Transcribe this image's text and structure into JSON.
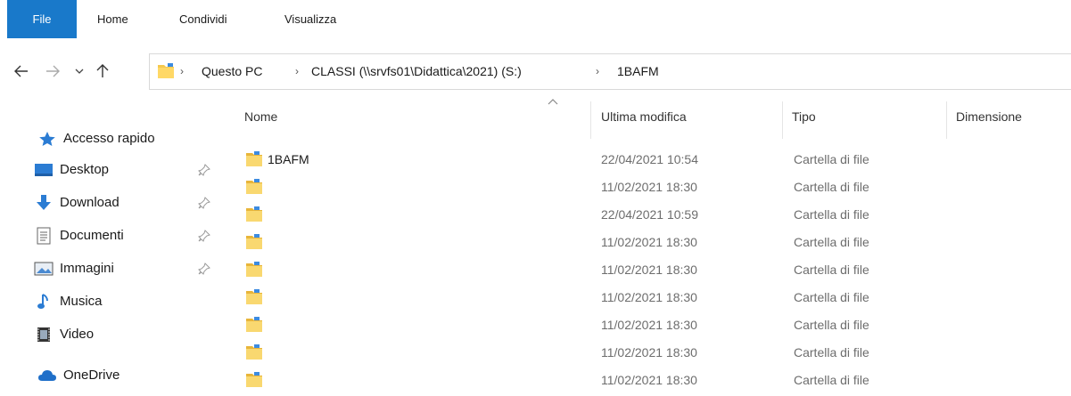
{
  "ribbon": {
    "tabs": [
      "File",
      "Home",
      "Condividi",
      "Visualizza"
    ]
  },
  "address": {
    "crumbs": [
      "Questo PC",
      "CLASSI (\\\\srvfs01\\Didattica\\2021) (S:)",
      "1BAFM"
    ],
    "folder_icon": "folder-icon"
  },
  "navigation": {
    "back_icon": "arrow-left-icon",
    "forward_icon": "arrow-right-icon",
    "recent_icon": "chevron-down-icon",
    "up_icon": "arrow-up-icon"
  },
  "sidebar": {
    "quick_access": "Accesso rapido",
    "items": [
      {
        "label": "Desktop",
        "icon": "desktop-icon",
        "pinned": true
      },
      {
        "label": "Download",
        "icon": "download-icon",
        "pinned": true
      },
      {
        "label": "Documenti",
        "icon": "documents-icon",
        "pinned": true
      },
      {
        "label": "Immagini",
        "icon": "pictures-icon",
        "pinned": true
      },
      {
        "label": "Musica",
        "icon": "music-icon",
        "pinned": false
      },
      {
        "label": "Video",
        "icon": "video-icon",
        "pinned": false
      }
    ],
    "onedrive": "OneDrive"
  },
  "list": {
    "columns": {
      "name": "Nome",
      "modified": "Ultima modifica",
      "type": "Tipo",
      "size": "Dimensione"
    },
    "rows": [
      {
        "name": "1BAFM",
        "modified": "22/04/2021 10:54",
        "type": "Cartella di file"
      },
      {
        "name": "",
        "modified": "11/02/2021 18:30",
        "type": "Cartella di file"
      },
      {
        "name": "",
        "modified": "22/04/2021 10:59",
        "type": "Cartella di file"
      },
      {
        "name": "",
        "modified": "11/02/2021 18:30",
        "type": "Cartella di file"
      },
      {
        "name": "",
        "modified": "11/02/2021 18:30",
        "type": "Cartella di file"
      },
      {
        "name": "",
        "modified": "11/02/2021 18:30",
        "type": "Cartella di file"
      },
      {
        "name": "",
        "modified": "11/02/2021 18:30",
        "type": "Cartella di file"
      },
      {
        "name": "",
        "modified": "11/02/2021 18:30",
        "type": "Cartella di file"
      },
      {
        "name": "",
        "modified": "11/02/2021 18:30",
        "type": "Cartella di file"
      }
    ]
  },
  "colors": {
    "accent": "#1979ca",
    "folder": "#f5c94e",
    "muted_text": "#6d6d6d"
  }
}
